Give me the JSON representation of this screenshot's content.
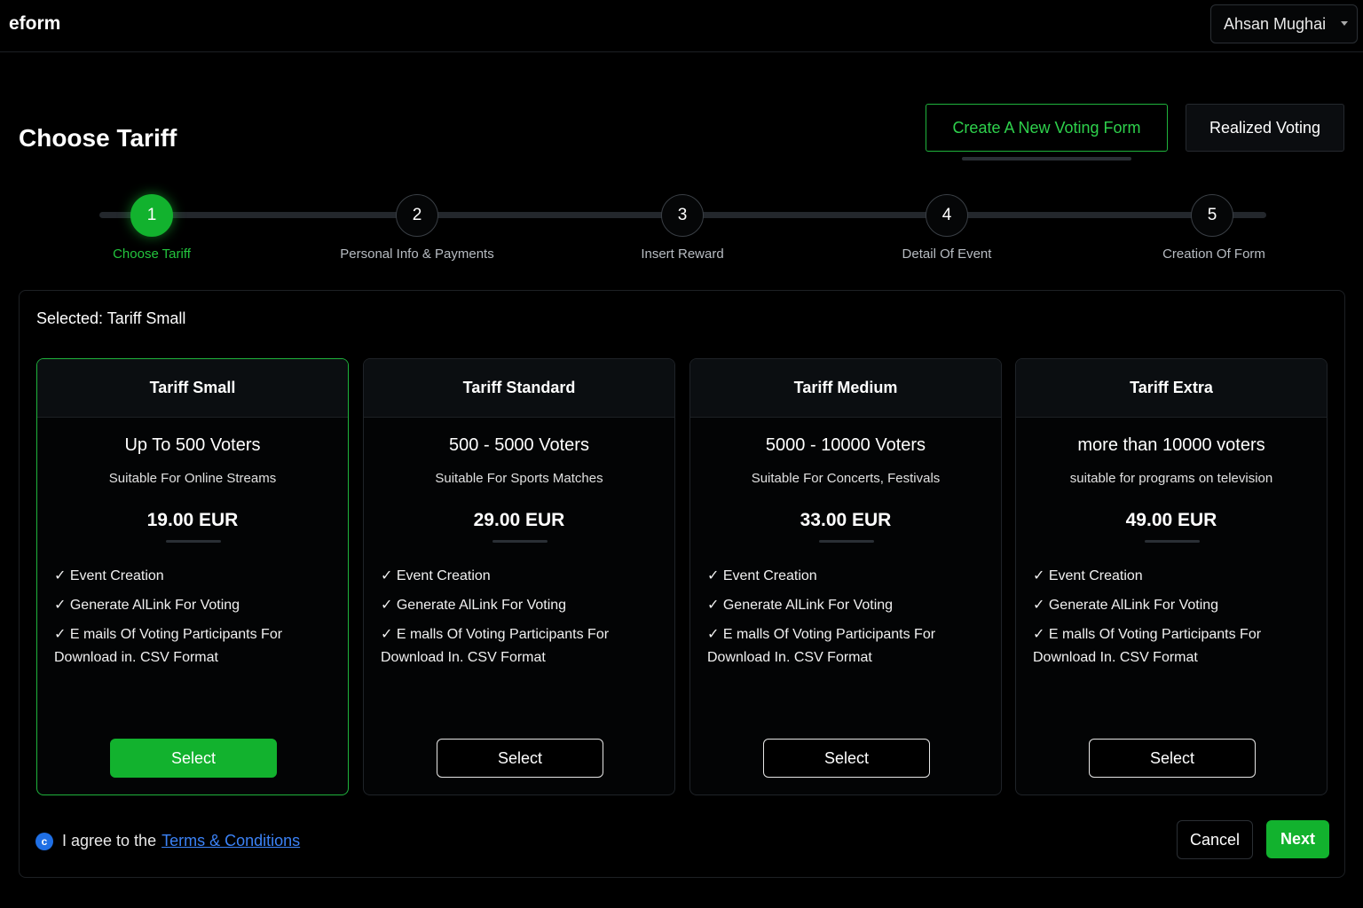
{
  "header": {
    "logo": "eform",
    "user_name": "Ahsan Mughai"
  },
  "page_title": "Choose Tariff",
  "actions": {
    "create_label": "Create A New Voting Form",
    "realized_label": "Realized Voting"
  },
  "steps": [
    {
      "number": "1",
      "label": "Choose Tariff"
    },
    {
      "number": "2",
      "label": "Personal Info & Payments"
    },
    {
      "number": "3",
      "label": "Insert Reward"
    },
    {
      "number": "4",
      "label": "Detail Of Event"
    },
    {
      "number": "5",
      "label": "Creation Of Form"
    }
  ],
  "active_step": 1,
  "selected_text": "Selected: Tariff Small",
  "tariffs": [
    {
      "title": "Tariff Small",
      "voters": "Up To 500 Voters",
      "suitable": "Suitable For Online Streams",
      "price": "19.00 EUR",
      "features": [
        "✓ Event Creation",
        "✓ Generate AlLink For Voting",
        "✓ E  mails Of Voting Participants For Download in. CSV Format"
      ],
      "button": "Select"
    },
    {
      "title": "Tariff Standard",
      "voters": "500 - 5000 Voters",
      "suitable": "Suitable For Sports Matches",
      "price": "29.00 EUR",
      "features": [
        "✓ Event Creation",
        "✓ Generate AlLink For Voting",
        "✓ E  malls Of Voting Participants For Download In. CSV Format"
      ],
      "button": "Select"
    },
    {
      "title": "Tariff Medium",
      "voters": "5000 - 10000 Voters",
      "suitable": "Suitable For Concerts, Festivals",
      "price": "33.00 EUR",
      "features": [
        "✓ Event Creation",
        "✓ Generate AlLink For Voting",
        "✓ E  malls Of Voting Participants For Download In. CSV Format"
      ],
      "button": "Select"
    },
    {
      "title": "Tariff Extra",
      "voters": "more than 10000 voters",
      "suitable": "suitable for programs on television",
      "price": "49.00 EUR",
      "features": [
        "✓ Event Creation",
        "✓ Generate AlLink For Voting",
        "✓ E  malls Of Voting Participants For Download In. CSV Format"
      ],
      "button": "Select"
    }
  ],
  "agree": {
    "text": "I agree to the",
    "link": "Terms & Conditions",
    "checkbox_glyph": "c"
  },
  "footer": {
    "cancel_label": "Cancel",
    "next_label": "Next"
  },
  "colors": {
    "accent": "#12b22e",
    "link": "#3b82f6"
  }
}
